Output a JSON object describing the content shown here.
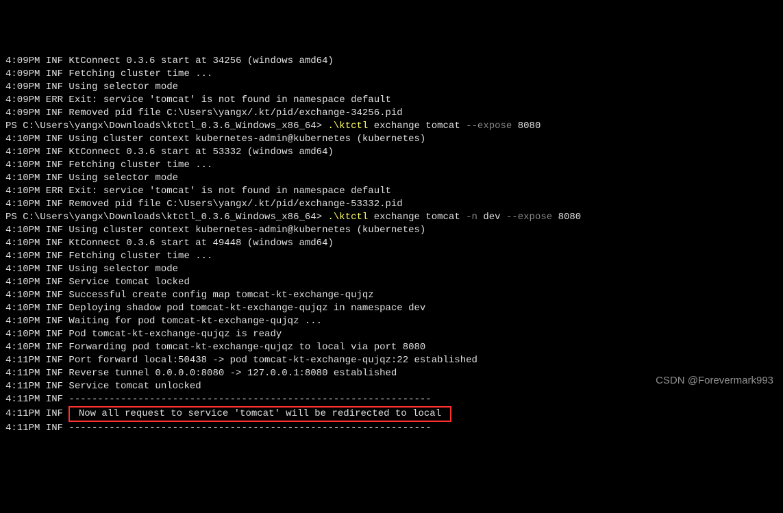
{
  "lines": [
    {
      "type": "plain",
      "text": "4:09PM INF KtConnect 0.3.6 start at 34256 (windows amd64)"
    },
    {
      "type": "plain",
      "text": "4:09PM INF Fetching cluster time ..."
    },
    {
      "type": "plain",
      "text": "4:09PM INF Using selector mode"
    },
    {
      "type": "plain",
      "text": "4:09PM ERR Exit: service 'tomcat' is not found in namespace default"
    },
    {
      "type": "plain",
      "text": "4:09PM INF Removed pid file C:\\Users\\yangx/.kt/pid/exchange-34256.pid"
    },
    {
      "type": "cmd",
      "prompt": "PS C:\\Users\\yangx\\Downloads\\ktctl_0.3.6_Windows_x86_64> ",
      "exec": ".\\ktctl",
      "args": " exchange tomcat ",
      "flag": "--expose",
      "port": " 8080"
    },
    {
      "type": "plain",
      "text": "4:10PM INF Using cluster context kubernetes-admin@kubernetes (kubernetes)"
    },
    {
      "type": "plain",
      "text": "4:10PM INF KtConnect 0.3.6 start at 53332 (windows amd64)"
    },
    {
      "type": "plain",
      "text": "4:10PM INF Fetching cluster time ..."
    },
    {
      "type": "plain",
      "text": "4:10PM INF Using selector mode"
    },
    {
      "type": "plain",
      "text": "4:10PM ERR Exit: service 'tomcat' is not found in namespace default"
    },
    {
      "type": "plain",
      "text": "4:10PM INF Removed pid file C:\\Users\\yangx/.kt/pid/exchange-53332.pid"
    },
    {
      "type": "cmd2",
      "prompt": "PS C:\\Users\\yangx\\Downloads\\ktctl_0.3.6_Windows_x86_64> ",
      "exec": ".\\ktctl",
      "args1": " exchange tomcat ",
      "flag1": "-n",
      "args2": " dev ",
      "flag2": "--expose",
      "port": " 8080"
    },
    {
      "type": "plain",
      "text": "4:10PM INF Using cluster context kubernetes-admin@kubernetes (kubernetes)"
    },
    {
      "type": "plain",
      "text": "4:10PM INF KtConnect 0.3.6 start at 49448 (windows amd64)"
    },
    {
      "type": "plain",
      "text": "4:10PM INF Fetching cluster time ..."
    },
    {
      "type": "plain",
      "text": "4:10PM INF Using selector mode"
    },
    {
      "type": "plain",
      "text": "4:10PM INF Service tomcat locked"
    },
    {
      "type": "plain",
      "text": "4:10PM INF Successful create config map tomcat-kt-exchange-qujqz"
    },
    {
      "type": "plain",
      "text": "4:10PM INF Deploying shadow pod tomcat-kt-exchange-qujqz in namespace dev"
    },
    {
      "type": "plain",
      "text": "4:10PM INF Waiting for pod tomcat-kt-exchange-qujqz ..."
    },
    {
      "type": "plain",
      "text": "4:10PM INF Pod tomcat-kt-exchange-qujqz is ready"
    },
    {
      "type": "plain",
      "text": "4:10PM INF Forwarding pod tomcat-kt-exchange-qujqz to local via port 8080"
    },
    {
      "type": "plain",
      "text": "4:11PM INF Port forward local:50438 -> pod tomcat-kt-exchange-qujqz:22 established"
    },
    {
      "type": "plain",
      "text": "4:11PM INF Reverse tunnel 0.0.0.0:8080 -> 127.0.0.1:8080 established"
    },
    {
      "type": "plain",
      "text": "4:11PM INF Service tomcat unlocked"
    },
    {
      "type": "plain",
      "text": "4:11PM INF ---------------------------------------------------------------"
    },
    {
      "type": "boxed",
      "prefix": "4:11PM INF ",
      "boxed": " Now all request to service 'tomcat' will be redirected to local "
    },
    {
      "type": "plain",
      "text": "4:11PM INF ---------------------------------------------------------------"
    }
  ],
  "watermark": "CSDN @Forevermark993"
}
